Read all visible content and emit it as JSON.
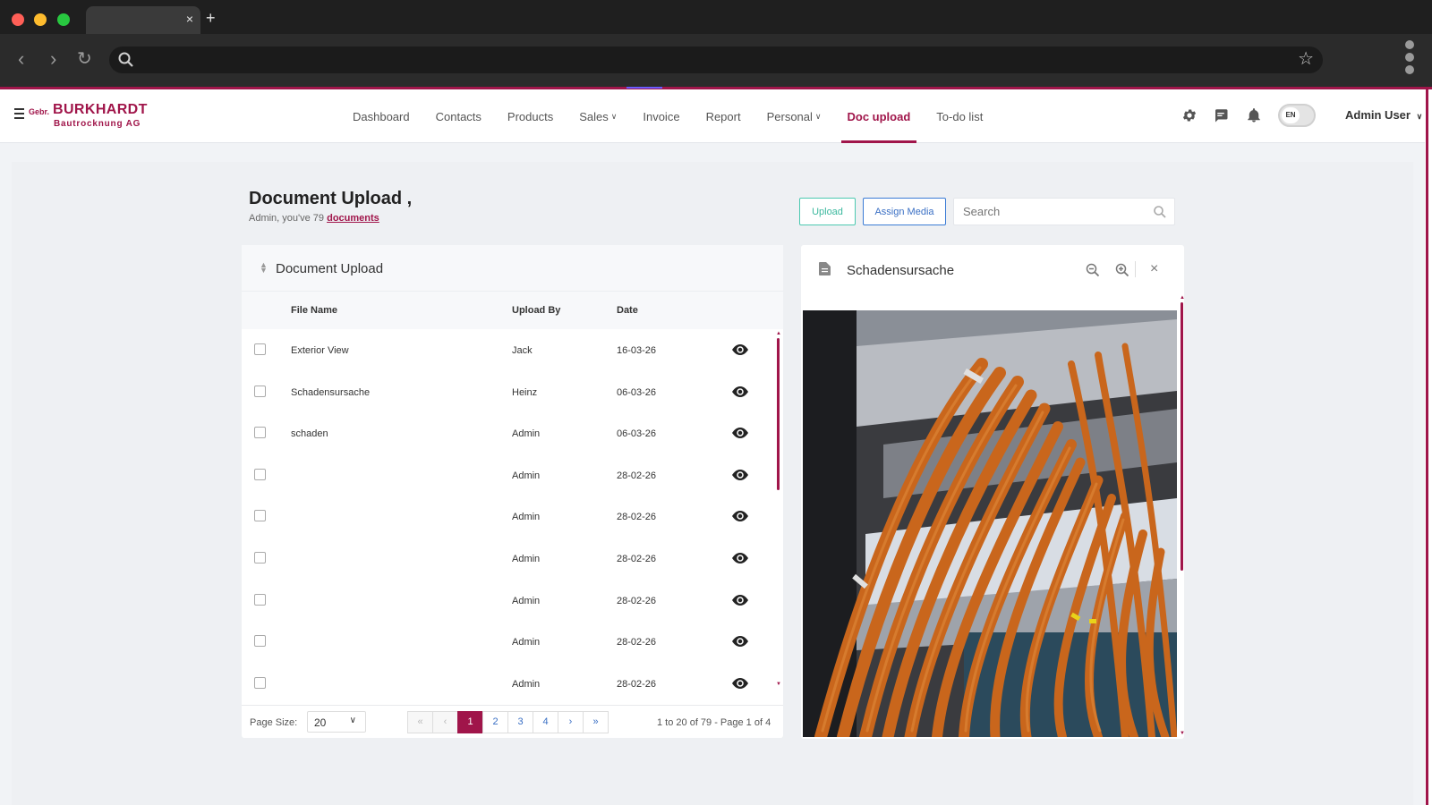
{
  "browser": {
    "tab_close": "×",
    "new_tab": "+",
    "url": ""
  },
  "brand": {
    "prefix": "Gebr.",
    "name": "BURKHARDT",
    "sub": "Bautrocknung AG"
  },
  "nav": {
    "items": [
      {
        "label": "Dashboard",
        "caret": false
      },
      {
        "label": "Contacts",
        "caret": false
      },
      {
        "label": "Products",
        "caret": false
      },
      {
        "label": "Sales",
        "caret": true
      },
      {
        "label": "Invoice",
        "caret": false
      },
      {
        "label": "Report",
        "caret": false
      },
      {
        "label": "Personal",
        "caret": true
      },
      {
        "label": "Doc upload",
        "caret": false,
        "active": true
      },
      {
        "label": "To-do list",
        "caret": false
      }
    ],
    "language": "EN",
    "user": "Admin User"
  },
  "page": {
    "title": "Document Upload ,",
    "subtitle_prefix": "Admin, you've 79 ",
    "subtitle_link": "documents",
    "upload_label": "Upload",
    "assign_label": "Assign Media",
    "search_placeholder": "Search"
  },
  "table": {
    "card_title": "Document Upload",
    "headers": {
      "file": "File Name",
      "upload_by": "Upload By",
      "date": "Date"
    },
    "rows": [
      {
        "file": "Exterior View",
        "by": "Jack",
        "date": "16-03-26"
      },
      {
        "file": "Schadensursache",
        "by": "Heinz",
        "date": "06-03-26"
      },
      {
        "file": "schaden",
        "by": "Admin",
        "date": "06-03-26"
      },
      {
        "file": "",
        "by": "Admin",
        "date": "28-02-26"
      },
      {
        "file": "",
        "by": "Admin",
        "date": "28-02-26"
      },
      {
        "file": "",
        "by": "Admin",
        "date": "28-02-26"
      },
      {
        "file": "",
        "by": "Admin",
        "date": "28-02-26"
      },
      {
        "file": "",
        "by": "Admin",
        "date": "28-02-26"
      },
      {
        "file": "",
        "by": "Admin",
        "date": "28-02-26"
      }
    ],
    "page_size_label": "Page Size:",
    "page_size_value": "20",
    "pagination": {
      "first": "«",
      "prev": "‹",
      "pages": [
        "1",
        "2",
        "3",
        "4"
      ],
      "current": "1",
      "next": "›",
      "last": "»"
    },
    "info": "1 to 20 of 79 - Page 1 of 4"
  },
  "viewer": {
    "title": "Schadensursache",
    "close": "×"
  },
  "colors": {
    "brand": "#a0154a",
    "upload": "#3bb89e",
    "assign": "#3a6fc4"
  }
}
